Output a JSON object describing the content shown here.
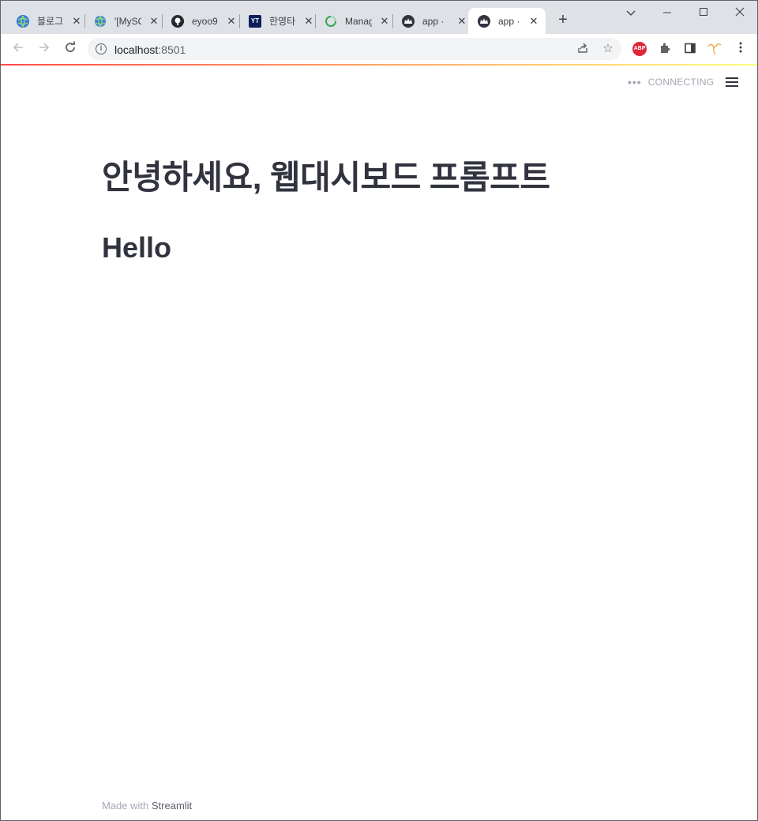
{
  "browser": {
    "tabs": [
      {
        "title": "블로그",
        "icon": "globe-icon",
        "color": "#2f6cd6"
      },
      {
        "title": "'[MySQ",
        "icon": "globe-icon",
        "color": "#2f6cd6"
      },
      {
        "title": "eyoo9",
        "icon": "github-icon",
        "color": "#24292f"
      },
      {
        "title": "한영타",
        "icon": "yt-icon",
        "color": "#0b1f5a"
      },
      {
        "title": "Manag",
        "icon": "loading-ring-icon",
        "color": "#34a853"
      },
      {
        "title": "app · ",
        "icon": "streamlit-crown-icon",
        "color": "#31333f"
      },
      {
        "title": "app · ",
        "icon": "streamlit-crown-icon",
        "color": "#31333f"
      }
    ],
    "new_tab": "+",
    "url_host": "localhost",
    "url_port": ":8501"
  },
  "streamlit": {
    "status": "CONNECTING",
    "title": "안녕하세요, 웹대시보드 프롬프트",
    "subtitle": "Hello",
    "footer_prefix": "Made with ",
    "footer_brand": "Streamlit"
  }
}
